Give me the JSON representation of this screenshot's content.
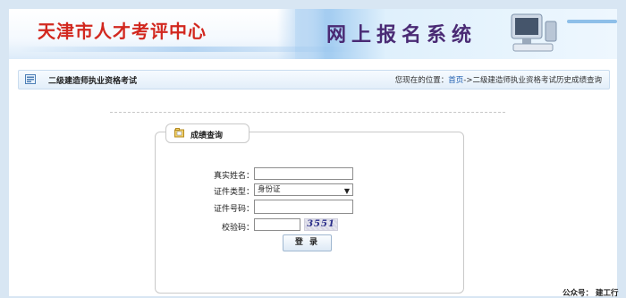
{
  "banner": {
    "site_title": "天津市人才考评中心",
    "system_title": "网上报名系统"
  },
  "nav": {
    "section_title": "二级建造师执业资格考试",
    "location_prefix": "您现在的位置：",
    "home_link": "首页",
    "trail": "->二级建造师执业资格考试历史成绩查询"
  },
  "form": {
    "tab_label": "成绩查询",
    "name_label": "真实姓名：",
    "name_value": "",
    "cert_type_label": "证件类型：",
    "cert_type_value": "身份证",
    "cert_no_label": "证件号码：",
    "cert_no_value": "",
    "captcha_label": "校验码：",
    "captcha_value": "",
    "captcha_text": "3551",
    "login_label": "登 录"
  },
  "footer": {
    "note": "公众号： 建工行"
  },
  "colors": {
    "title_red": "#d2281f",
    "system_purple": "#4a2a74",
    "link_blue": "#1f5fb0",
    "background": "#d8e6f3"
  }
}
